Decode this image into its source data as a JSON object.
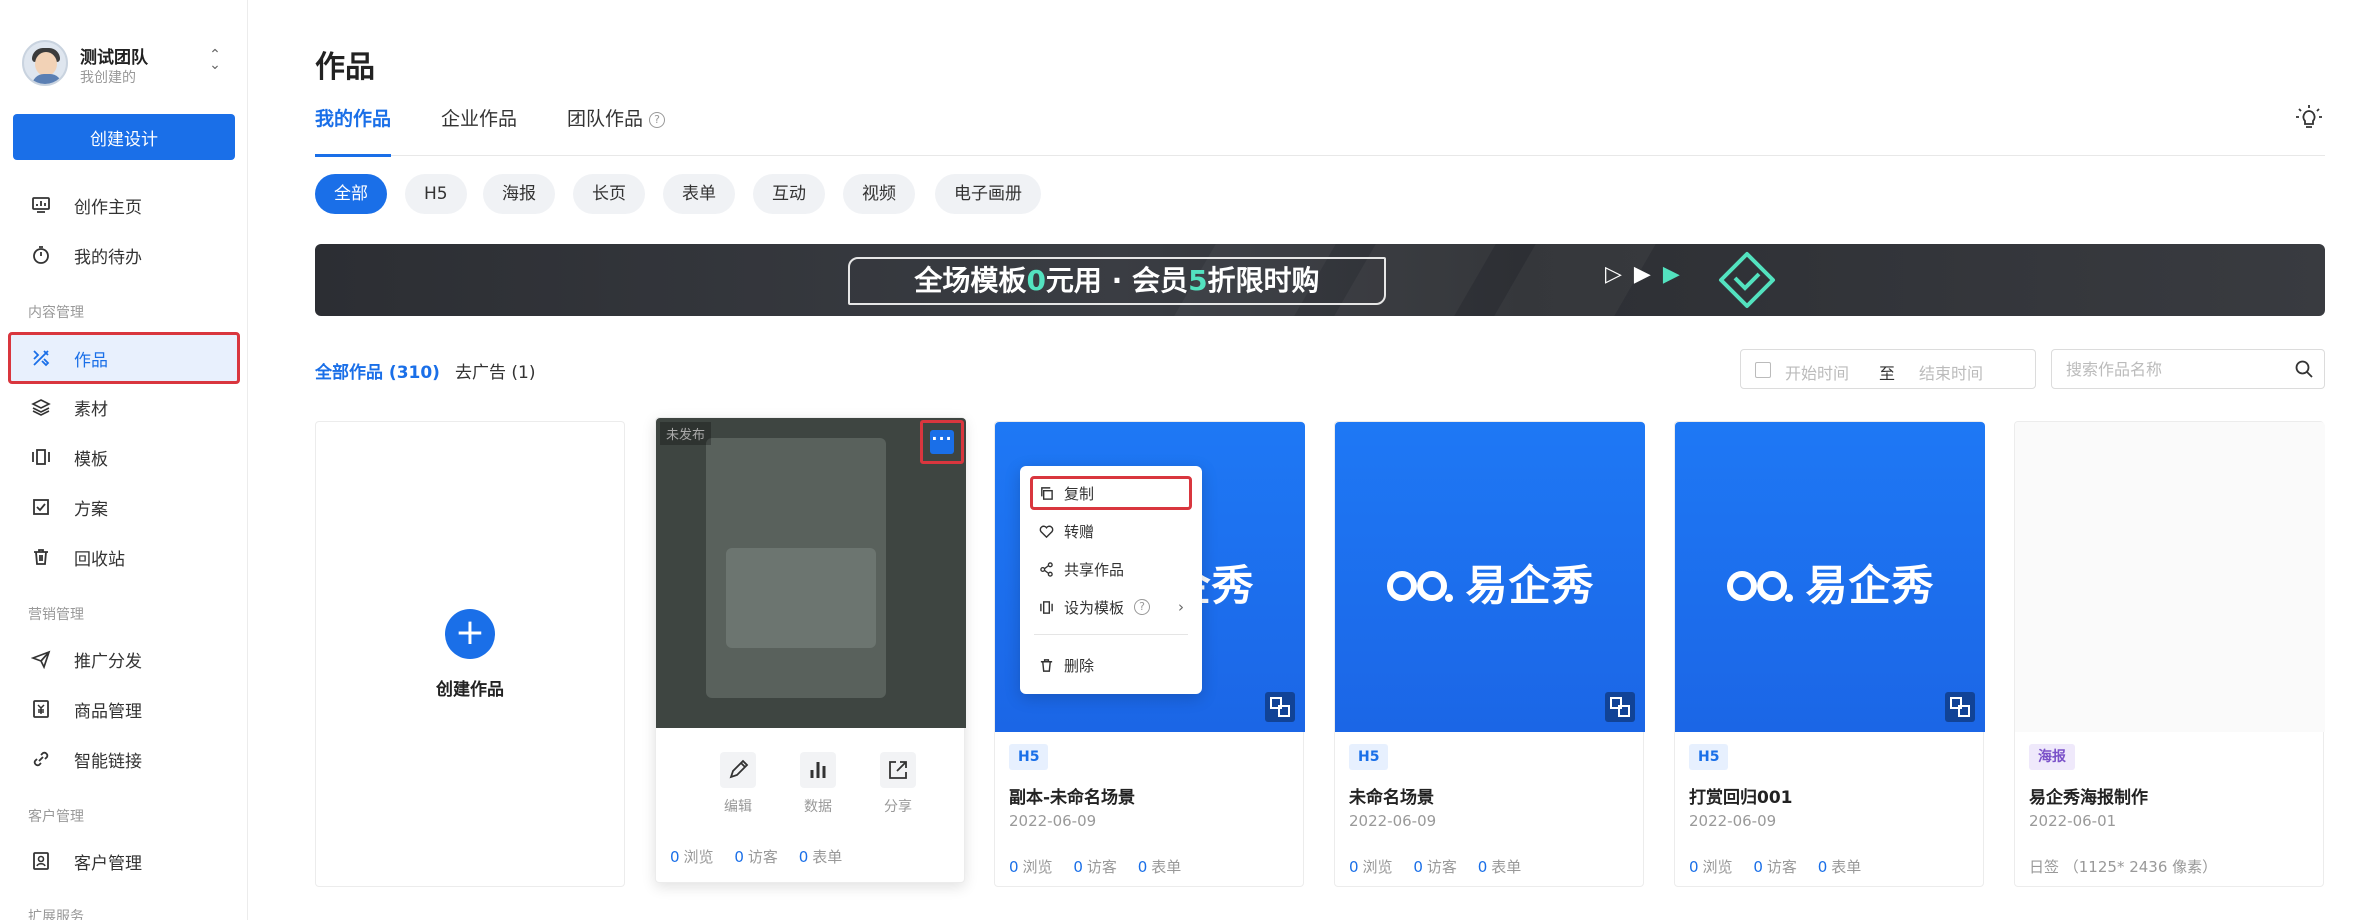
{
  "team": {
    "name": "测试团队",
    "subtitle": "我创建的"
  },
  "sidebar": {
    "create_label": "创建设计",
    "items_top": [
      {
        "label": "创作主页",
        "icon": "monitor-chart-icon"
      },
      {
        "label": "我的待办",
        "icon": "stopwatch-icon"
      }
    ],
    "groups": [
      {
        "label": "内容管理"
      },
      {
        "label": "营销管理"
      },
      {
        "label": "客户管理"
      },
      {
        "label": "扩展服务"
      }
    ],
    "content_items": [
      {
        "label": "作品",
        "icon": "tools-icon",
        "active": true
      },
      {
        "label": "素材",
        "icon": "layers-icon"
      },
      {
        "label": "模板",
        "icon": "template-icon"
      },
      {
        "label": "方案",
        "icon": "checklist-icon"
      },
      {
        "label": "回收站",
        "icon": "trash-icon"
      }
    ],
    "marketing_items": [
      {
        "label": "推广分发",
        "icon": "send-icon"
      },
      {
        "label": "商品管理",
        "icon": "product-icon"
      },
      {
        "label": "智能链接",
        "icon": "link-icon"
      }
    ],
    "customer_items": [
      {
        "label": "客户管理",
        "icon": "contact-icon"
      }
    ]
  },
  "main": {
    "title": "作品",
    "tabs": [
      {
        "label": "我的作品",
        "active": true
      },
      {
        "label": "企业作品"
      },
      {
        "label": "团队作品"
      }
    ],
    "filters": [
      "全部",
      "H5",
      "海报",
      "长页",
      "表单",
      "互动",
      "视频",
      "电子画册"
    ],
    "banner": {
      "text_a": "全场模板",
      "text_b": "0",
      "text_c": "元用 · 会员",
      "text_d": "5",
      "text_e": "折限时购"
    },
    "count_tabs": [
      {
        "label": "全部作品 (310)",
        "active": true
      },
      {
        "label": "去广告 (1)"
      }
    ],
    "date_range": {
      "start": "开始时间",
      "separator": "至",
      "end": "结束时间"
    },
    "search": {
      "placeholder": "搜索作品名称",
      "value": ""
    }
  },
  "cards": {
    "create_label": "创建作品",
    "first": {
      "status": "未发布",
      "actions": [
        {
          "label": "编辑",
          "icon": "pencil-icon"
        },
        {
          "label": "数据",
          "icon": "bar-chart-icon"
        },
        {
          "label": "分享",
          "icon": "share-icon"
        }
      ],
      "stats": {
        "views": "0",
        "views_label": "浏览",
        "visitors": "0",
        "visitors_label": "访客",
        "forms": "0",
        "forms_label": "表单"
      }
    },
    "brand_text": "易企秀",
    "items": [
      {
        "type": "H5",
        "title": "副本-未命名场景",
        "date": "2022-06-09",
        "views": "0",
        "visitors": "0",
        "forms": "0"
      },
      {
        "type": "H5",
        "title": "未命名场景",
        "date": "2022-06-09",
        "views": "0",
        "visitors": "0",
        "forms": "0"
      },
      {
        "type": "H5",
        "title": "打赏回归001",
        "date": "2022-06-09",
        "views": "0",
        "visitors": "0",
        "forms": "0"
      },
      {
        "type": "海报",
        "title": "易企秀海报制作",
        "date": "2022-06-01",
        "size": "日签 （1125* 2436 像素）"
      }
    ],
    "stat_labels": {
      "views": "浏览",
      "visitors": "访客",
      "forms": "表单"
    }
  },
  "menu": {
    "items": [
      {
        "label": "复制",
        "icon": "copy-icon",
        "highlighted": true
      },
      {
        "label": "转赠",
        "icon": "heart-icon"
      },
      {
        "label": "共享作品",
        "icon": "share-nodes-icon"
      },
      {
        "label": "设为模板",
        "icon": "template-icon"
      },
      {
        "label": "删除",
        "icon": "trash-icon"
      }
    ]
  },
  "colors": {
    "primary": "#1a6fe8",
    "highlight_border": "#d9363e",
    "accent_green": "#53e2bf"
  }
}
